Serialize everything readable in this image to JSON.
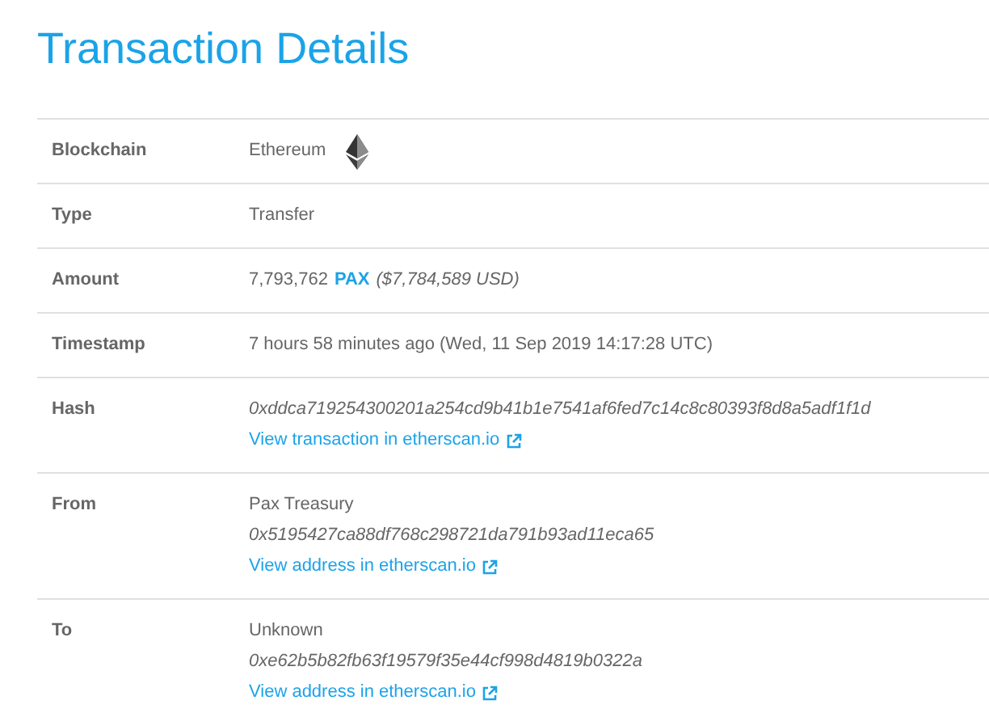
{
  "title": "Transaction Details",
  "rows": [
    {
      "label": "Blockchain",
      "lines": [
        {
          "kind": "chain",
          "text": "Ethereum"
        }
      ]
    },
    {
      "label": "Type",
      "lines": [
        {
          "kind": "text",
          "text": "Transfer"
        }
      ]
    },
    {
      "label": "Amount",
      "lines": [
        {
          "kind": "amount",
          "amount": "7,793,762",
          "token": "PAX",
          "usd": "($7,784,589 USD)"
        }
      ]
    },
    {
      "label": "Timestamp",
      "lines": [
        {
          "kind": "text",
          "text": "7 hours 58 minutes ago (Wed, 11 Sep 2019 14:17:28 UTC)"
        }
      ]
    },
    {
      "label": "Hash",
      "lines": [
        {
          "kind": "hash",
          "text": "0xddca719254300201a254cd9b41b1e7541af6fed7c14c8c80393f8d8a5adf1f1d"
        },
        {
          "kind": "link",
          "text": "View transaction in etherscan.io"
        }
      ]
    },
    {
      "label": "From",
      "lines": [
        {
          "kind": "text",
          "text": "Pax Treasury"
        },
        {
          "kind": "hash",
          "text": "0x5195427ca88df768c298721da791b93ad11eca65"
        },
        {
          "kind": "link",
          "text": "View address in etherscan.io"
        }
      ]
    },
    {
      "label": "To",
      "lines": [
        {
          "kind": "text",
          "text": "Unknown"
        },
        {
          "kind": "hash",
          "text": "0xe62b5b82fb63f19579f35e44cf998d4819b0322a"
        },
        {
          "kind": "link",
          "text": "View address in etherscan.io"
        }
      ]
    }
  ]
}
